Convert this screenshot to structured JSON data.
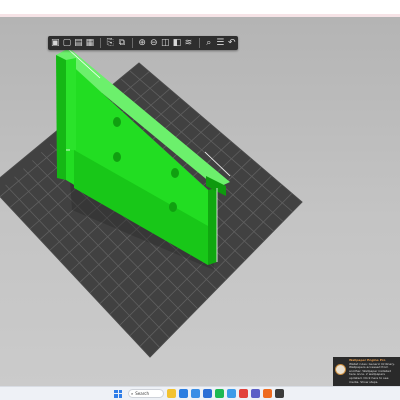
{
  "toolbar": {
    "buttons": [
      {
        "name": "add-object-icon",
        "label": "add"
      },
      {
        "name": "delete-icon",
        "label": "delete"
      },
      {
        "name": "delete-all-icon",
        "label": "delete all"
      },
      {
        "name": "arrange-icon",
        "label": "arrange"
      },
      {
        "name": "copy-icon",
        "label": "copy"
      },
      {
        "name": "paste-icon",
        "label": "paste"
      },
      {
        "name": "add-instance-icon",
        "label": "add instance"
      },
      {
        "name": "remove-instance-icon",
        "label": "remove instance"
      },
      {
        "name": "split-objects-icon",
        "label": "split"
      },
      {
        "name": "split-parts-icon",
        "label": "split parts"
      },
      {
        "name": "variable-layer-icon",
        "label": "variable layer height"
      },
      {
        "name": "search-icon",
        "label": "search"
      },
      {
        "name": "layers-icon",
        "label": "layers"
      },
      {
        "name": "undo-icon",
        "label": "undo"
      }
    ]
  },
  "notification": {
    "title": "Wallpaper Engine Pro",
    "body": "Wallet rules: Generic Ordinary. Wallpapers accessed from another. Wallpaper installed here once. 2 wallpapers updated. Click here to see",
    "footer": "media. Show steps."
  },
  "taskbar": {
    "search_placeholder": "Search",
    "apps": [
      {
        "name": "file-explorer-icon",
        "color": "#f2c230"
      },
      {
        "name": "browser-icon",
        "color": "#2a7de1"
      },
      {
        "name": "store-icon",
        "color": "#3a8ee6"
      },
      {
        "name": "mail-icon",
        "color": "#2b6fd6"
      },
      {
        "name": "spotify-icon",
        "color": "#1db954"
      },
      {
        "name": "photos-icon",
        "color": "#3c9be8"
      },
      {
        "name": "chrome-icon",
        "color": "#e2423b"
      },
      {
        "name": "teams-icon",
        "color": "#5b5fc7"
      },
      {
        "name": "slicer-icon",
        "color": "#ee6b1f"
      },
      {
        "name": "terminal-icon",
        "color": "#3b3b3b"
      }
    ]
  },
  "colors": {
    "model": "#1cd81c",
    "model_dark": "#12a612",
    "bed": "#414141",
    "grid": "#5a5a5a",
    "viewport": "#c4c4c4"
  }
}
